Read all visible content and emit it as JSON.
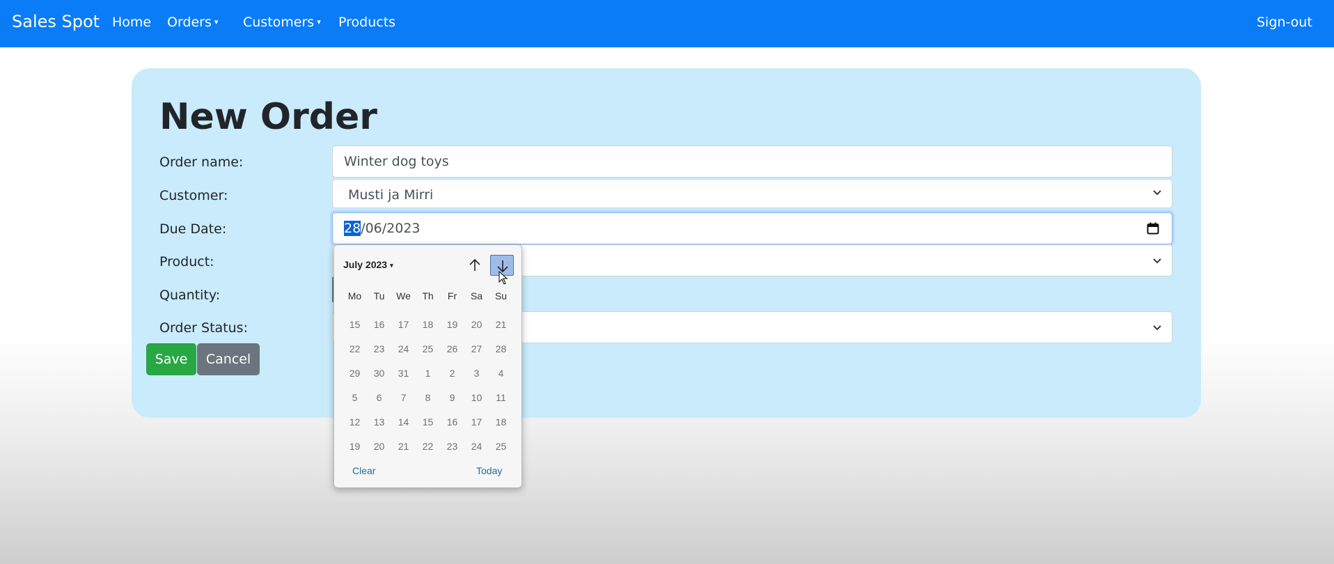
{
  "navbar": {
    "brand": "Sales Spot",
    "links": [
      "Home",
      "Orders",
      "Customers",
      "Products"
    ],
    "caret": "▾",
    "signout": "Sign-out",
    "bg_color": "#0a7cf8"
  },
  "form": {
    "title": "New Order",
    "order_name_label": "Order name:",
    "order_name_value": "Winter dog toys",
    "customer_label": "Customer:",
    "customer_value": "Musti ja Mirri",
    "due_date_label": "Due Date:",
    "due_date_day": "28",
    "due_date_rest": "/06/2023",
    "product_label": "Product:",
    "quantity_label": "Quantity:",
    "status_label": "Order Status:",
    "save_label": "Save",
    "cancel_label": "Cancel",
    "card_color": "#c9ebfb"
  },
  "datepicker": {
    "month_label": "July 2023",
    "month_caret": "▾",
    "weekdays": [
      "Mo",
      "Tu",
      "We",
      "Th",
      "Fr",
      "Sa",
      "Su"
    ],
    "weeks": [
      [
        "15",
        "16",
        "17",
        "18",
        "19",
        "20",
        "21"
      ],
      [
        "22",
        "23",
        "24",
        "25",
        "26",
        "27",
        "28"
      ],
      [
        "29",
        "30",
        "31",
        "1",
        "2",
        "3",
        "4"
      ],
      [
        "5",
        "6",
        "7",
        "8",
        "9",
        "10",
        "11"
      ],
      [
        "12",
        "13",
        "14",
        "15",
        "16",
        "17",
        "18"
      ],
      [
        "19",
        "20",
        "21",
        "22",
        "23",
        "24",
        "25"
      ]
    ],
    "clear_label": "Clear",
    "today_label": "Today",
    "icons": [
      "arrow-up-icon",
      "arrow-down-icon"
    ]
  }
}
